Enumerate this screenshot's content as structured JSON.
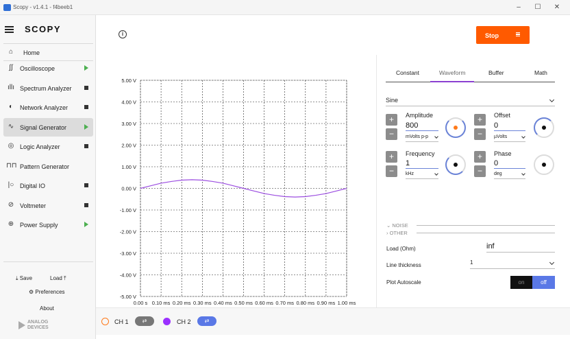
{
  "window": {
    "title": "Scopy - v1.4.1 - f4beeb1",
    "minimize": "–",
    "maximize": "☐",
    "close": "✕"
  },
  "sidebar": {
    "logo": "SCOPY",
    "home": "Home",
    "items": [
      {
        "label": "Oscilloscope",
        "icon": "oscilloscope-icon",
        "glyph": "∫∫",
        "indicator": "play"
      },
      {
        "label": "Spectrum Analyzer",
        "icon": "spectrum-icon",
        "glyph": "ıllı",
        "indicator": "square"
      },
      {
        "label": "Network Analyzer",
        "icon": "network-icon",
        "glyph": "◐",
        "indicator": "square"
      },
      {
        "label": "Signal Generator",
        "icon": "signal-generator-icon",
        "glyph": "∿",
        "indicator": "play",
        "active": true
      },
      {
        "label": "Logic Analyzer",
        "icon": "logic-analyzer-icon",
        "glyph": "◎",
        "indicator": "square"
      },
      {
        "label": "Pattern Generator",
        "icon": "pattern-generator-icon",
        "glyph": "⊓⊓",
        "indicator": "none"
      },
      {
        "label": "Digital IO",
        "icon": "digital-io-icon",
        "glyph": "|○",
        "indicator": "square"
      },
      {
        "label": "Voltmeter",
        "icon": "voltmeter-icon",
        "glyph": "⊘",
        "indicator": "square"
      },
      {
        "label": "Power Supply",
        "icon": "power-supply-icon",
        "glyph": "⊕",
        "indicator": "play"
      }
    ],
    "save": "Save",
    "load": "Load",
    "preferences": "Preferences",
    "about": "About",
    "brand_line1": "ANALOG",
    "brand_line2": "DEVICES"
  },
  "topbar": {
    "info": "i",
    "stop": "Stop"
  },
  "plot": {
    "y_ticks": [
      "5.00 V",
      "4.00 V",
      "3.00 V",
      "2.00 V",
      "1.00 V",
      "0.00 V",
      "-1.00 V",
      "-2.00 V",
      "-3.00 V",
      "-4.00 V",
      "-5.00 V"
    ],
    "x_ticks": [
      "0.00 s",
      "0.10 ms",
      "0.20 ms",
      "0.30 ms",
      "0.40 ms",
      "0.50 ms",
      "0.60 ms",
      "0.70 ms",
      "0.80 ms",
      "0.90 ms",
      "1.00 ms"
    ],
    "trace_color": "#9b4de0"
  },
  "chart_data": {
    "type": "line",
    "x": [
      0,
      0.05,
      0.1,
      0.15,
      0.2,
      0.25,
      0.3,
      0.35,
      0.4,
      0.45,
      0.5,
      0.55,
      0.6,
      0.65,
      0.7,
      0.75,
      0.8,
      0.85,
      0.9,
      0.95,
      1.0
    ],
    "series": [
      {
        "values": [
          0,
          0.12,
          0.24,
          0.32,
          0.38,
          0.4,
          0.38,
          0.32,
          0.24,
          0.12,
          0,
          -0.12,
          -0.24,
          -0.32,
          -0.38,
          -0.4,
          -0.38,
          -0.32,
          -0.24,
          -0.12,
          0
        ]
      }
    ],
    "ylim": [
      -5,
      5
    ],
    "xlim": [
      0,
      1.0
    ],
    "grid": true
  },
  "channels": [
    {
      "label": "CH 1",
      "color": "#ff7a1a",
      "toggle_color": "#777777"
    },
    {
      "label": "CH 2",
      "color": "#9b30ff",
      "toggle_color": "#5a78e6"
    }
  ],
  "panel": {
    "tabs": [
      "Constant",
      "Waveform",
      "Buffer",
      "Math"
    ],
    "active_tab": "Waveform",
    "waveform": "Sine",
    "amplitude": {
      "title": "Amplitude",
      "value": "800",
      "unit": "mVolts p-p"
    },
    "offset": {
      "title": "Offset",
      "value": "0",
      "unit": "µVolts"
    },
    "frequency": {
      "title": "Frequency",
      "value": "1",
      "unit": "kHz"
    },
    "phase": {
      "title": "Phase",
      "value": "0",
      "unit": "deg"
    },
    "plus": "+",
    "minus": "−",
    "noise": "NOISE",
    "other": "OTHER",
    "load_label": "Load (Ohm)",
    "load_value": "inf",
    "thickness_label": "Line thickness",
    "thickness_value": "1",
    "autoscale_label": "Plot Autoscale",
    "autoscale_on": "on",
    "autoscale_off": "off"
  }
}
